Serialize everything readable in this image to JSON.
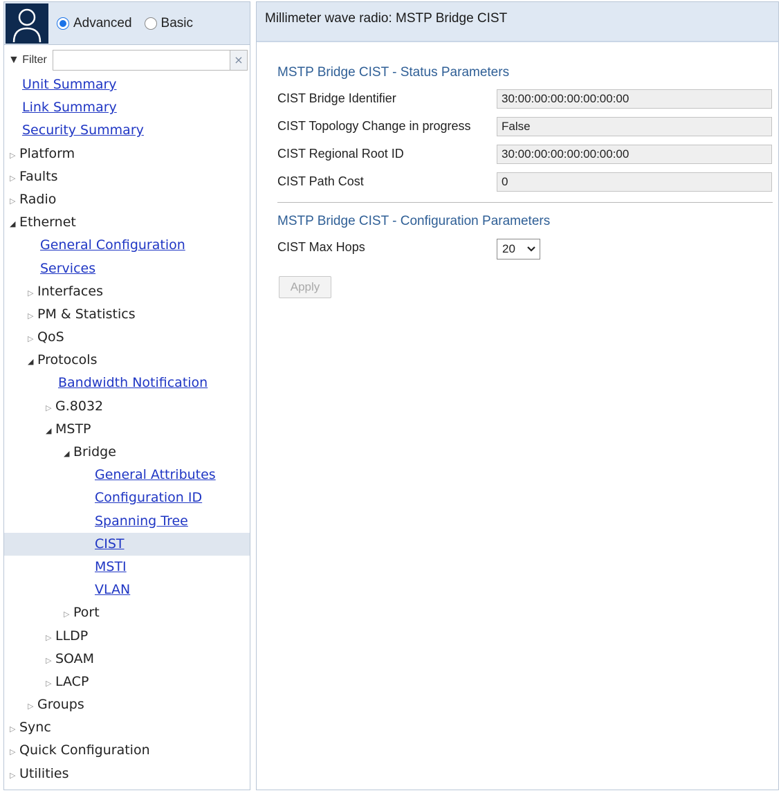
{
  "nav": {
    "mode": {
      "options": [
        "Advanced",
        "Basic"
      ],
      "selected": "Advanced"
    },
    "filter": {
      "label": "▼ Filter",
      "value": "",
      "clear_symbol": "×"
    },
    "tree": [
      {
        "label": "Unit Summary",
        "type": "link",
        "level": 0
      },
      {
        "label": "Link Summary",
        "type": "link",
        "level": 0
      },
      {
        "label": "Security Summary",
        "type": "link",
        "level": 0
      },
      {
        "label": "Platform",
        "type": "collapsed",
        "level": 0
      },
      {
        "label": "Faults",
        "type": "collapsed",
        "level": 0
      },
      {
        "label": "Radio",
        "type": "collapsed",
        "level": 0
      },
      {
        "label": "Ethernet",
        "type": "expanded",
        "level": 0
      },
      {
        "label": "General Configuration",
        "type": "link",
        "level": 1
      },
      {
        "label": "Services",
        "type": "link",
        "level": 1
      },
      {
        "label": "Interfaces",
        "type": "collapsed",
        "level": 1
      },
      {
        "label": "PM & Statistics",
        "type": "collapsed",
        "level": 1
      },
      {
        "label": "QoS",
        "type": "collapsed",
        "level": 1
      },
      {
        "label": "Protocols",
        "type": "expanded",
        "level": 1
      },
      {
        "label": "Bandwidth Notification",
        "type": "link",
        "level": 2
      },
      {
        "label": "G.8032",
        "type": "collapsed",
        "level": 2
      },
      {
        "label": "MSTP",
        "type": "expanded",
        "level": 2
      },
      {
        "label": "Bridge",
        "type": "expanded",
        "level": 3
      },
      {
        "label": "General Attributes",
        "type": "link",
        "level": 4
      },
      {
        "label": "Configuration ID",
        "type": "link",
        "level": 4
      },
      {
        "label": "Spanning Tree",
        "type": "link",
        "level": 4
      },
      {
        "label": "CIST",
        "type": "link",
        "level": 4,
        "selected": true
      },
      {
        "label": "MSTI",
        "type": "link",
        "level": 4
      },
      {
        "label": "VLAN",
        "type": "link",
        "level": 4
      },
      {
        "label": "Port",
        "type": "collapsed",
        "level": 3
      },
      {
        "label": "LLDP",
        "type": "collapsed",
        "level": 2
      },
      {
        "label": "SOAM",
        "type": "collapsed",
        "level": 2
      },
      {
        "label": "LACP",
        "type": "collapsed",
        "level": 2
      },
      {
        "label": "Groups",
        "type": "collapsed",
        "level": 1
      },
      {
        "label": "Sync",
        "type": "collapsed",
        "level": 0
      },
      {
        "label": "Quick Configuration",
        "type": "collapsed",
        "level": 0
      },
      {
        "label": "Utilities",
        "type": "collapsed",
        "level": 0
      }
    ]
  },
  "page": {
    "title": "Millimeter wave radio: MSTP Bridge CIST",
    "status_section": {
      "title": "MSTP Bridge CIST - Status Parameters",
      "rows": [
        {
          "label": "CIST Bridge Identifier",
          "value": "30:00:00:00:00:00:00:00"
        },
        {
          "label": "CIST Topology Change in progress",
          "value": "False"
        },
        {
          "label": "CIST Regional Root ID",
          "value": "30:00:00:00:00:00:00:00"
        },
        {
          "label": "CIST Path Cost",
          "value": "0"
        }
      ]
    },
    "config_section": {
      "title": "MSTP Bridge CIST - Configuration Parameters",
      "max_hops_label": "CIST Max Hops",
      "max_hops_value": "20"
    },
    "apply_label": "Apply"
  },
  "colors": {
    "link": "#1f36c4",
    "section_title": "#2f5f96",
    "header_bg": "#dfe8f3",
    "selected_row_bg": "#dfe6ef",
    "user_box": "#0e2a4f"
  }
}
